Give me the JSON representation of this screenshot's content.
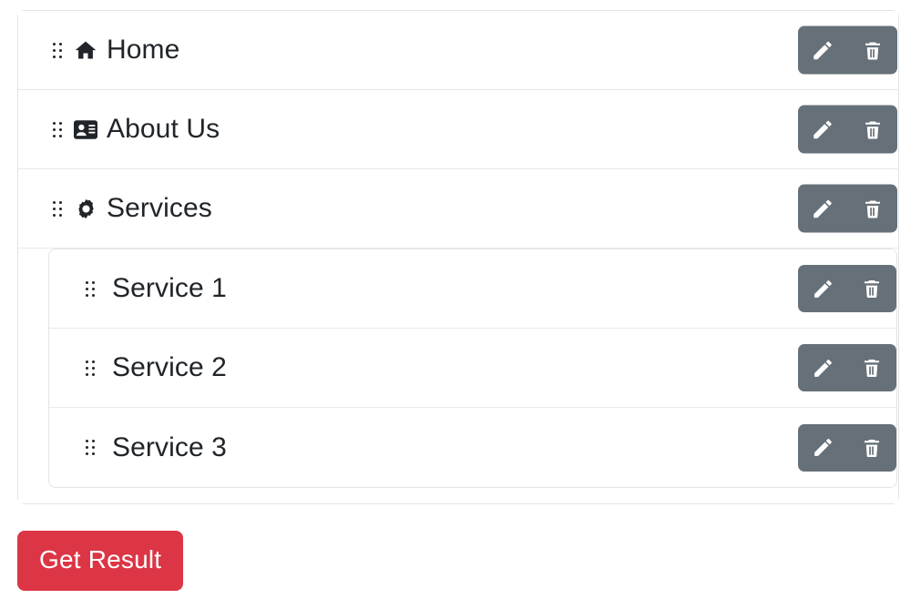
{
  "colors": {
    "accent_red": "#dc3545",
    "action_group_gray": "#667078",
    "text": "#212529",
    "border": "#e3e4e6",
    "row_divider": "#e8e9ea",
    "page_background": "#ffffff"
  },
  "menu": {
    "items": [
      {
        "label": "Home",
        "icon": "home-icon",
        "drag_handle": "drag-handle-icon",
        "actions": {
          "edit": {
            "icon": "pencil-icon",
            "title": "Edit"
          },
          "delete": {
            "icon": "trash-icon",
            "title": "Delete"
          }
        },
        "children": []
      },
      {
        "label": "About Us",
        "icon": "id-card-icon",
        "drag_handle": "drag-handle-icon",
        "actions": {
          "edit": {
            "icon": "pencil-icon",
            "title": "Edit"
          },
          "delete": {
            "icon": "trash-icon",
            "title": "Delete"
          }
        },
        "children": []
      },
      {
        "label": "Services",
        "icon": "gear-icon",
        "drag_handle": "drag-handle-icon",
        "actions": {
          "edit": {
            "icon": "pencil-icon",
            "title": "Edit"
          },
          "delete": {
            "icon": "trash-icon",
            "title": "Delete"
          }
        },
        "children": [
          {
            "label": "Service 1",
            "drag_handle": "drag-handle-icon",
            "actions": {
              "edit": {
                "icon": "pencil-icon",
                "title": "Edit"
              },
              "delete": {
                "icon": "trash-icon",
                "title": "Delete"
              }
            }
          },
          {
            "label": "Service 2",
            "drag_handle": "drag-handle-icon",
            "actions": {
              "edit": {
                "icon": "pencil-icon",
                "title": "Edit"
              },
              "delete": {
                "icon": "trash-icon",
                "title": "Delete"
              }
            }
          },
          {
            "label": "Service 3",
            "drag_handle": "drag-handle-icon",
            "actions": {
              "edit": {
                "icon": "pencil-icon",
                "title": "Edit"
              },
              "delete": {
                "icon": "trash-icon",
                "title": "Delete"
              }
            }
          }
        ]
      }
    ]
  },
  "footer": {
    "get_result_label": "Get Result"
  }
}
